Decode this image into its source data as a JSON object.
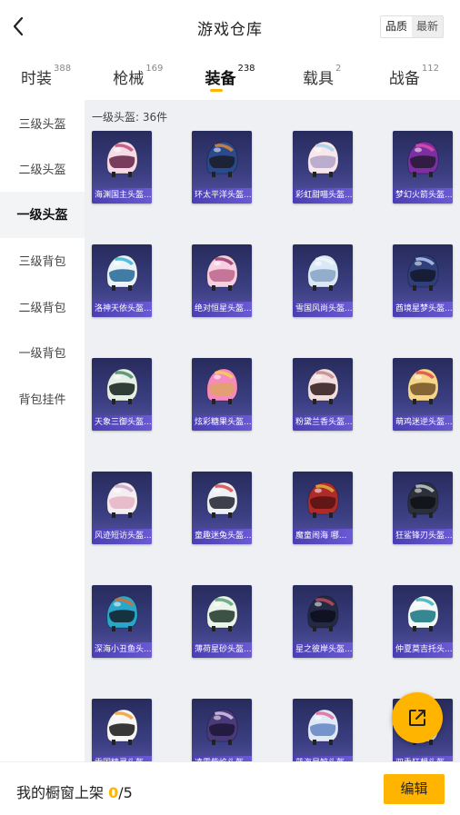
{
  "header": {
    "title": "游戏仓库",
    "sort_options": [
      {
        "label": "品质",
        "active": true
      },
      {
        "label": "最新",
        "active": false
      }
    ]
  },
  "tabs": [
    {
      "label": "时装",
      "count": "388",
      "active": false
    },
    {
      "label": "枪械",
      "count": "169",
      "active": false
    },
    {
      "label": "装备",
      "count": "238",
      "active": true
    },
    {
      "label": "载具",
      "count": "2",
      "active": false
    },
    {
      "label": "战备",
      "count": "112",
      "active": false
    }
  ],
  "sidebar": {
    "items": [
      {
        "label": "三级头盔",
        "active": false
      },
      {
        "label": "二级头盔",
        "active": false
      },
      {
        "label": "一级头盔",
        "active": true
      },
      {
        "label": "三级背包",
        "active": false
      },
      {
        "label": "二级背包",
        "active": false
      },
      {
        "label": "一级背包",
        "active": false
      },
      {
        "label": "背包挂件",
        "active": false
      }
    ]
  },
  "section": {
    "title": "一级头盔: 36件"
  },
  "items": [
    {
      "name": "海渊国主头盔...",
      "shell": "#f4dbe6",
      "accent": "#c24a7a",
      "visor": "#6b2a4a"
    },
    {
      "name": "环太平洋头盔...",
      "shell": "#2a4a8c",
      "accent": "#e0843a",
      "visor": "#1b1f2c"
    },
    {
      "name": "彩虹甜喵头盔...",
      "shell": "#f7e6ec",
      "accent": "#9fd4ea",
      "visor": "#b4a6c8"
    },
    {
      "name": "梦幻火箭头盔...",
      "shell": "#7b2fa0",
      "accent": "#e04ba8",
      "visor": "#2a1b3a"
    },
    {
      "name": "洛神天依头盔...",
      "shell": "#e9f3f8",
      "accent": "#38b3d6",
      "visor": "#2f6f9a"
    },
    {
      "name": "绝对恒星头盔...",
      "shell": "#f6cfe0",
      "accent": "#9a3a6a",
      "visor": "#c06a90"
    },
    {
      "name": "雪国风尚头盔...",
      "shell": "#dbe8f5",
      "accent": "#f0f4fa",
      "visor": "#8aa7c8"
    },
    {
      "name": "酋境星梦头盔...",
      "shell": "#2e3f7a",
      "accent": "#b9c6f0",
      "visor": "#151a30"
    },
    {
      "name": "天象三御头盔...",
      "shell": "#e6efe6",
      "accent": "#4a8a6a",
      "visor": "#1c2a24"
    },
    {
      "name": "炫彩糖果头盔...",
      "shell": "#f58ac0",
      "accent": "#f5d24a",
      "visor": "#e2a26a"
    },
    {
      "name": "粉黛兰香头盔...",
      "shell": "#f2dede",
      "accent": "#c28a8a",
      "visor": "#3a2222"
    },
    {
      "name": "萌鸡迷逆头盔...",
      "shell": "#f4d58a",
      "accent": "#e04a4a",
      "visor": "#7a5a2a"
    },
    {
      "name": "风迹短访头盔...",
      "shell": "#f4eef2",
      "accent": "#c7a6c8",
      "visor": "#e8b6c6"
    },
    {
      "name": "童趣迷兔头盔...",
      "shell": "#eef0f4",
      "accent": "#d24a4a",
      "visor": "#2a2e3a"
    },
    {
      "name": "魔童闹海 哪...",
      "shell": "#b02a2a",
      "accent": "#e0b03a",
      "visor": "#5a1414"
    },
    {
      "name": "狂鲨锋刃头盔...",
      "shell": "#2c3038",
      "accent": "#c8ccd4",
      "visor": "#111317"
    },
    {
      "name": "深海小丑鱼头...",
      "shell": "#2aa6c8",
      "accent": "#e06a2a",
      "visor": "#132630"
    },
    {
      "name": "薄荷星砂头盔...",
      "shell": "#eaf4ea",
      "accent": "#5aa07a",
      "visor": "#2a4032"
    },
    {
      "name": "星之彼岸头盔...",
      "shell": "#242a44",
      "accent": "#c04a5a",
      "visor": "#0e1020"
    },
    {
      "name": "仲夏莫吉托头...",
      "shell": "#f4f7f7",
      "accent": "#3ab0b8",
      "visor": "#207a86"
    },
    {
      "name": "雪国精灵头盔...",
      "shell": "#f6f6f6",
      "accent": "#f0a03a",
      "visor": "#222222"
    },
    {
      "name": "凌霄紫焰头盔...",
      "shell": "#4a3a7a",
      "accent": "#d8c6f0",
      "visor": "#20183a"
    },
    {
      "name": "蓝海星鲸头盔...",
      "shell": "#dfeaf6",
      "accent": "#e06a9a",
      "visor": "#6a8ac8"
    },
    {
      "name": "双重狂想头盔...",
      "shell": "#eaeaf2",
      "accent": "#a06aca",
      "visor": "#3a3a5a"
    }
  ],
  "footer": {
    "label": "我的橱窗上架",
    "current": "0",
    "separator": "/",
    "max": "5",
    "edit_label": "编辑"
  },
  "colors": {
    "accent": "#ffb400",
    "card_bg": "#3b3f82",
    "label_bg": "#5a4bc8"
  }
}
